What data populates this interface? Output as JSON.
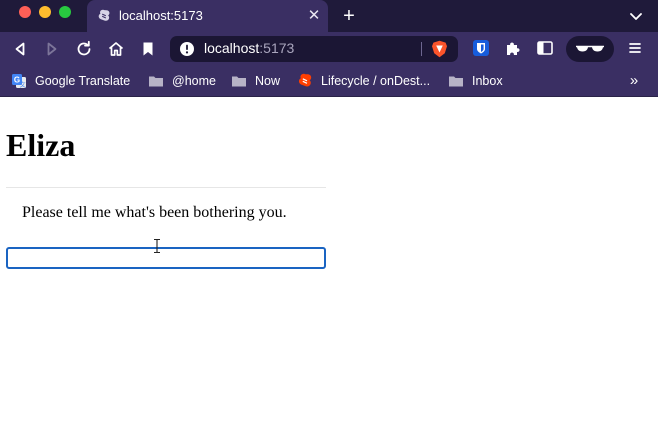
{
  "window": {
    "tab": {
      "title": "localhost:5173"
    }
  },
  "toolbar": {
    "url_host": "localhost",
    "url_port": ":5173"
  },
  "bookmarks": [
    {
      "label": "Google Translate",
      "icon": "google-translate-icon"
    },
    {
      "label": "@home",
      "icon": "folder-icon"
    },
    {
      "label": "Now",
      "icon": "folder-icon"
    },
    {
      "label": "Lifecycle / onDest...",
      "icon": "svelte-icon"
    },
    {
      "label": "Inbox",
      "icon": "folder-icon"
    }
  ],
  "page": {
    "heading": "Eliza",
    "prompt": "Please tell me what's been bothering you.",
    "input_value": ""
  },
  "colors": {
    "chrome_dark": "#1f1a3a",
    "chrome": "#3a2f63",
    "input_focus": "#1a64c2"
  }
}
